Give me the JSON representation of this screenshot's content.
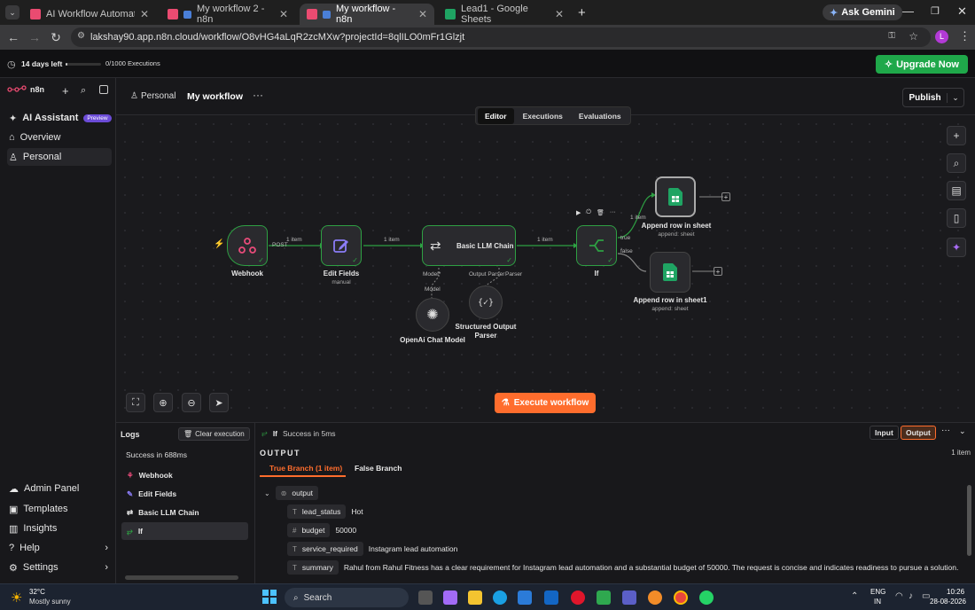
{
  "browser": {
    "tabs": [
      {
        "label": "AI Workflow Automation Platfo",
        "active": false
      },
      {
        "label": "My workflow 2 - n8n",
        "active": false
      },
      {
        "label": "My workflow - n8n",
        "active": true
      },
      {
        "label": "Lead1 - Google Sheets",
        "active": false
      }
    ],
    "new_tab": "+",
    "ask_gemini": "Ask Gemini",
    "url": "lakshay90.app.n8n.cloud/workflow/O8vHG4aLqR2zcMXw?projectId=8qlILO0mFr1Glzjt",
    "profile_initial": "L"
  },
  "banner": {
    "trial": "14 days left",
    "executions": "0/1000 Executions",
    "upgrade": "Upgrade Now"
  },
  "sidebar": {
    "brand": "n8n",
    "items": [
      {
        "label": "AI Assistant",
        "badge": "Preview"
      },
      {
        "label": "Overview"
      },
      {
        "label": "Personal"
      }
    ],
    "bottom": [
      {
        "label": "Admin Panel"
      },
      {
        "label": "Templates"
      },
      {
        "label": "Insights"
      },
      {
        "label": "Help"
      },
      {
        "label": "Settings"
      }
    ]
  },
  "header": {
    "project": "Personal",
    "workflow": "My workflow",
    "tabs": [
      "Editor",
      "Executions",
      "Evaluations"
    ],
    "active_tab": "Editor",
    "publish": "Publish"
  },
  "nodes": {
    "webhook": {
      "label": "Webhook"
    },
    "edit_fields": {
      "label": "Edit Fields",
      "sub": "manual"
    },
    "llm_chain": {
      "label": "Basic LLM Chain"
    },
    "if": {
      "label": "If"
    },
    "append1": {
      "label": "Append row in sheet",
      "sub": "append: sheet"
    },
    "append2": {
      "label": "Append row in sheet1",
      "sub": "append: sheet"
    },
    "openai": {
      "label": "OpenAi Chat Model"
    },
    "parser": {
      "label": "Structured Output Parser"
    }
  },
  "connections": {
    "post": "POST",
    "item1": "1 item",
    "item2": "1 item",
    "item3": "1 item",
    "item4": "1 item",
    "true": "true",
    "false": "false",
    "model": "Model*",
    "output_parser": "Output Parser",
    "model_small": "Model",
    "parser_small": "Parser"
  },
  "execute": "Execute workflow",
  "logs": {
    "title": "Logs",
    "clear": "Clear execution",
    "status": "Success in 688ms",
    "items": [
      "Webhook",
      "Edit Fields",
      "Basic LLM Chain",
      "If"
    ]
  },
  "output": {
    "node": "If",
    "status": "Success in 5ms",
    "input_btn": "Input",
    "output_btn": "Output",
    "heading": "OUTPUT",
    "count": "1 item",
    "tab_true": "True Branch (1 item)",
    "tab_false": "False Branch",
    "root": "output",
    "fields": [
      {
        "type": "T",
        "name": "lead_status",
        "value": "Hot"
      },
      {
        "type": "#",
        "name": "budget",
        "value": "50000"
      },
      {
        "type": "T",
        "name": "service_required",
        "value": "Instagram lead automation"
      },
      {
        "type": "T",
        "name": "summary",
        "value": "Rahul from Rahul Fitness has a clear requirement for Instagram lead automation and a substantial budget of 50000. The request is concise and indicates readiness to pursue a solution."
      }
    ]
  },
  "taskbar": {
    "temp": "32°C",
    "weather": "Mostly sunny",
    "search": "Search",
    "lang1": "ENG",
    "lang2": "IN",
    "time": "10:26",
    "date": "28-08-2026"
  },
  "colors": {
    "success": "#2ea043",
    "accent": "#ff6d2d",
    "upgrade": "#1fa84a"
  }
}
